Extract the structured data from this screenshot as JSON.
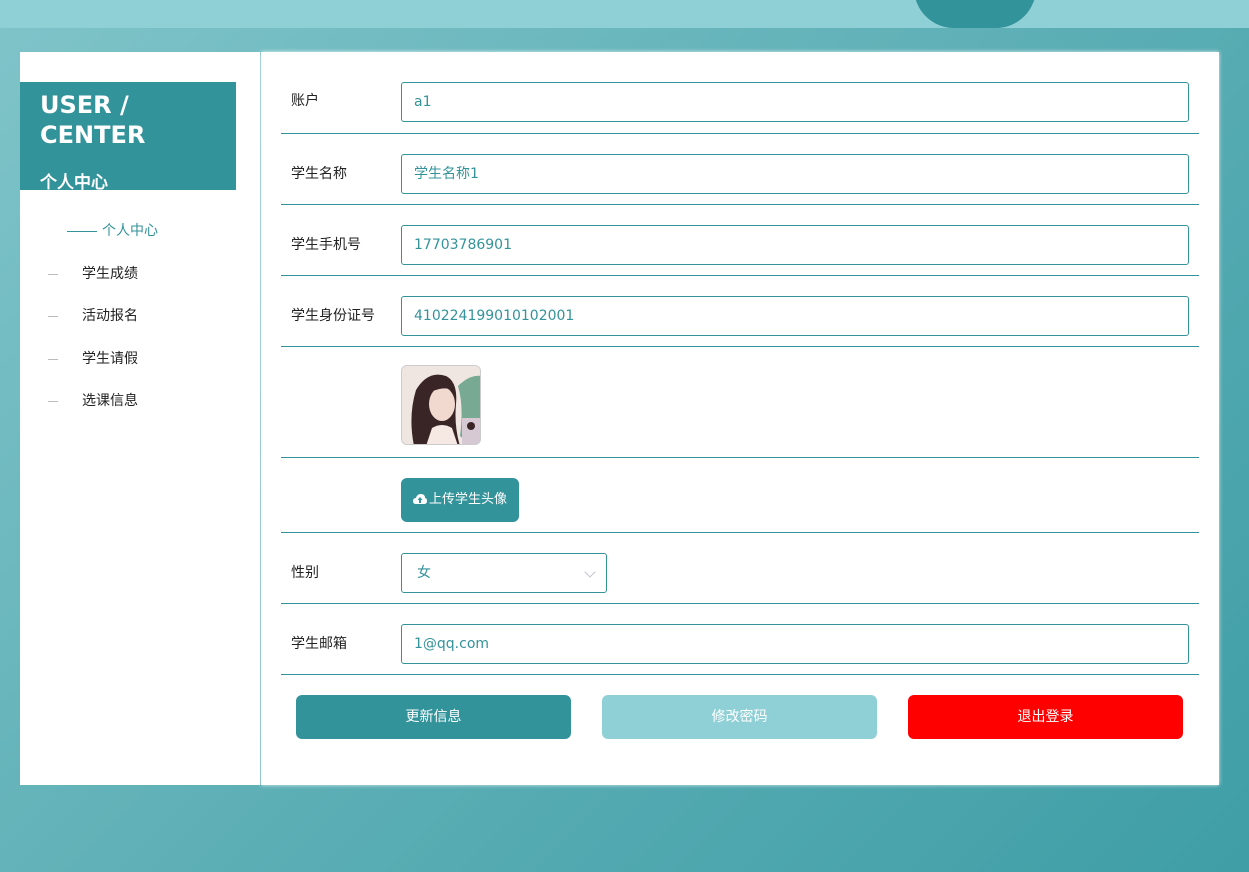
{
  "sidebar": {
    "title_en": "USER / CENTER",
    "title_zh": "个人中心",
    "items": [
      {
        "label": "个人中心",
        "active": true
      },
      {
        "label": "学生成绩"
      },
      {
        "label": "活动报名"
      },
      {
        "label": "学生请假"
      },
      {
        "label": "选课信息"
      }
    ]
  },
  "form": {
    "account": {
      "label": "账户",
      "value": "a1"
    },
    "student_name": {
      "label": "学生名称",
      "value": "学生名称1"
    },
    "phone": {
      "label": "学生手机号",
      "value": "17703786901"
    },
    "id_card": {
      "label": "学生身份证号",
      "value": "410224199010102001"
    },
    "upload_label": "上传学生头像",
    "gender": {
      "label": "性别",
      "value": "女"
    },
    "email": {
      "label": "学生邮箱",
      "value": "1@qq.com"
    }
  },
  "actions": {
    "update": "更新信息",
    "change_password": "修改密码",
    "logout": "退出登录"
  },
  "colors": {
    "accent": "#33939a",
    "light_accent": "#8fd0d6",
    "danger": "#ff0000"
  }
}
